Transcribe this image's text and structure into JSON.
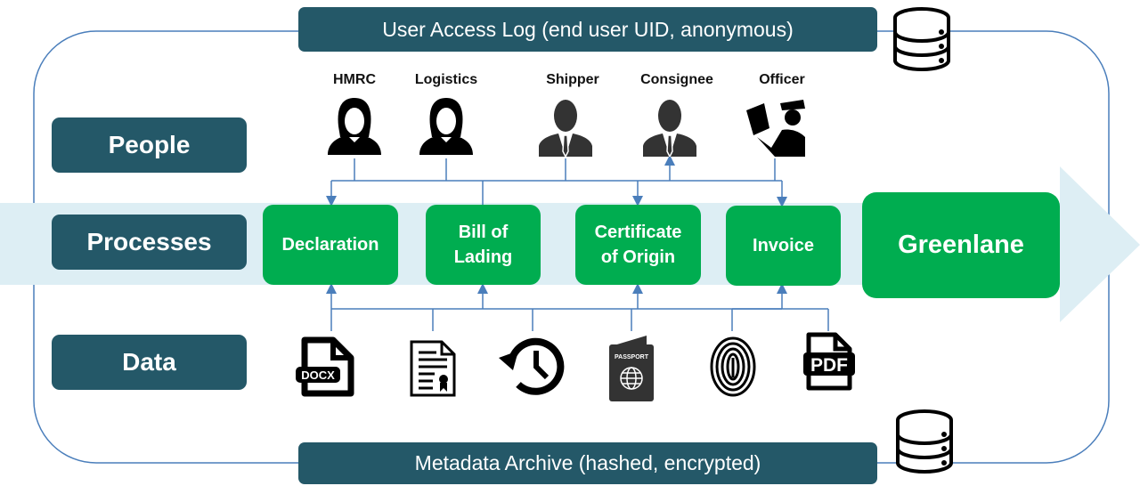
{
  "colors": {
    "dark_teal": "#245868",
    "green": "#00AD50",
    "flow_arrow": "#DDEEF4",
    "connector": "#4A7EBB"
  },
  "top_bar": {
    "label": "User Access Log (end user UID, anonymous)",
    "icon": "database-icon"
  },
  "bottom_bar": {
    "label": "Metadata Archive (hashed, encrypted)",
    "icon": "database-icon"
  },
  "rows": {
    "people": "People",
    "processes": "Processes",
    "data": "Data"
  },
  "people": [
    {
      "label": "HMRC",
      "icon": "woman-user-icon"
    },
    {
      "label": "Logistics",
      "icon": "woman-user-icon"
    },
    {
      "label": "Shipper",
      "icon": "businessman-icon"
    },
    {
      "label": "Consignee",
      "icon": "businessman-icon"
    },
    {
      "label": "Officer",
      "icon": "police-officer-icon"
    }
  ],
  "processes": [
    {
      "label": "Declaration"
    },
    {
      "label": "Bill of\nLading"
    },
    {
      "label": "Certificate\nof Origin"
    },
    {
      "label": "Invoice"
    }
  ],
  "outcome": {
    "label": "Greenlane"
  },
  "data_items": [
    {
      "icon": "docx-file-icon",
      "text": "DOCX"
    },
    {
      "icon": "certificate-document-icon"
    },
    {
      "icon": "history-clock-icon"
    },
    {
      "icon": "passport-icon",
      "text": "PASSPORT"
    },
    {
      "icon": "fingerprint-icon"
    },
    {
      "icon": "pdf-file-icon",
      "text": "PDF"
    }
  ]
}
